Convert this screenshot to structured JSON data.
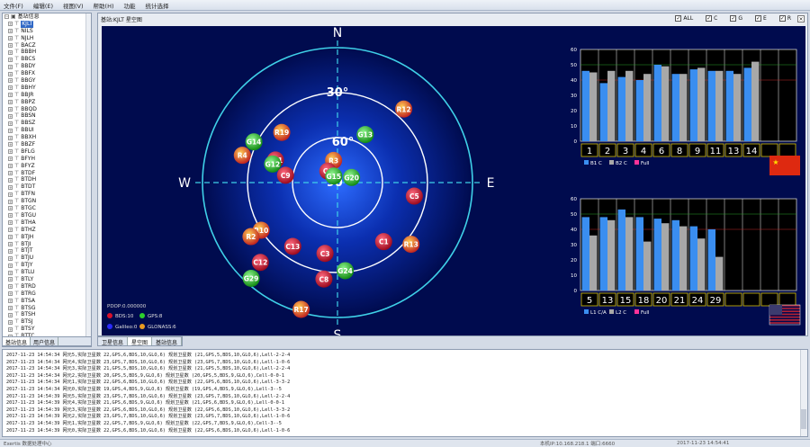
{
  "menu": [
    "文件(F)",
    "编辑(E)",
    "视图(V)",
    "帮助(H)",
    "功能",
    "统计选择"
  ],
  "tree": {
    "root": "基站信息",
    "items": [
      "KJLT",
      "NILS",
      "NJLH",
      "BACZ",
      "BBBH",
      "BBCS",
      "BBDY",
      "BBFX",
      "BBGY",
      "BBHY",
      "BBJR",
      "BBPZ",
      "BBQD",
      "BBSN",
      "BBSZ",
      "BBUI",
      "BBXH",
      "BBZF",
      "BFLG",
      "BFYH",
      "BFYZ",
      "BTDF",
      "BTDH",
      "BTDT",
      "BTFN",
      "BTGN",
      "BTGC",
      "BTGU",
      "BTHA",
      "BTHZ",
      "BTJH",
      "BTJI",
      "BTJT",
      "BTJU",
      "BTJY",
      "BTLU",
      "BTLY",
      "BTRD",
      "BTRG",
      "BTSA",
      "BTSG",
      "BTSH",
      "BTSJ",
      "BTSY",
      "BTTC",
      "BTTX"
    ],
    "selected": "KJLT"
  },
  "left_tabs": [
    "基站信息",
    "用户信息"
  ],
  "main": {
    "title": "基站:KJLT 星空图",
    "checkboxes": [
      {
        "label": "ALL",
        "checked": "✓"
      },
      {
        "label": "C",
        "checked": "✓"
      },
      {
        "label": "G",
        "checked": "✓"
      },
      {
        "label": "E",
        "checked": "✓"
      },
      {
        "label": "R",
        "checked": "✓"
      }
    ],
    "close": "×"
  },
  "main_tabs": [
    "卫星信息",
    "星空图",
    "基站信息"
  ],
  "sky": {
    "N": "N",
    "S": "S",
    "E": "E",
    "W": "W",
    "rings": [
      "30°",
      "60°",
      "90°"
    ],
    "pdop": "PDOP:0.000000",
    "legend": [
      {
        "label": "BDS:10",
        "color": "#d8102a"
      },
      {
        "label": "GPS:8",
        "color": "#2ccf2c"
      },
      {
        "label": "Galileo:0",
        "color": "#2a2aff"
      },
      {
        "label": "GLONASS:6",
        "color": "#e89a20"
      }
    ],
    "satellites": [
      {
        "id": "R19",
        "sys": "R",
        "az": 312,
        "el": 40
      },
      {
        "id": "G14",
        "sys": "G",
        "az": 296,
        "el": 28
      },
      {
        "id": "R4",
        "sys": "R",
        "az": 286,
        "el": 24
      },
      {
        "id": "C11",
        "sys": "C",
        "az": 290,
        "el": 46
      },
      {
        "id": "G12",
        "sys": "G",
        "az": 286,
        "el": 45
      },
      {
        "id": "C9",
        "sys": "C",
        "az": 278,
        "el": 55
      },
      {
        "id": "R3",
        "sys": "R",
        "az": 350,
        "el": 75
      },
      {
        "id": "C6",
        "sys": "C",
        "az": 320,
        "el": 80
      },
      {
        "id": "G15",
        "sys": "G",
        "az": 330,
        "el": 85
      },
      {
        "id": "G20",
        "sys": "G",
        "az": 70,
        "el": 80
      },
      {
        "id": "G13",
        "sys": "G",
        "az": 30,
        "el": 53
      },
      {
        "id": "R12",
        "sys": "R",
        "az": 42,
        "el": 24
      },
      {
        "id": "C5",
        "sys": "C",
        "az": 100,
        "el": 38
      },
      {
        "id": "R13",
        "sys": "R",
        "az": 130,
        "el": 26
      },
      {
        "id": "R10",
        "sys": "R",
        "az": 238,
        "el": 30
      },
      {
        "id": "R2",
        "sys": "R",
        "az": 238,
        "el": 22
      },
      {
        "id": "C12",
        "sys": "C",
        "az": 224,
        "el": 16
      },
      {
        "id": "C13",
        "sys": "C",
        "az": 215,
        "el": 38
      },
      {
        "id": "C3",
        "sys": "C",
        "az": 190,
        "el": 42
      },
      {
        "id": "C1",
        "sys": "C",
        "az": 142,
        "el": 40
      },
      {
        "id": "G24",
        "sys": "G",
        "az": 175,
        "el": 31
      },
      {
        "id": "C8",
        "sys": "C",
        "az": 188,
        "el": 25
      },
      {
        "id": "G29",
        "sys": "G",
        "az": 222,
        "el": 4
      },
      {
        "id": "R17",
        "sys": "R",
        "az": 196,
        "el": 2
      }
    ]
  },
  "snr_top": {
    "y_ticks": [
      "60",
      "50",
      "40",
      "30",
      "20",
      "10",
      "0"
    ],
    "sats": [
      "1",
      "2",
      "3",
      "4",
      "6",
      "8",
      "9",
      "11",
      "13",
      "14"
    ],
    "b1": [
      46,
      38,
      42,
      40,
      50,
      44,
      47,
      46,
      46,
      48
    ],
    "b2": [
      45,
      46,
      46,
      44,
      49,
      44,
      48,
      46,
      44,
      52
    ],
    "legend": [
      "B1 C",
      "B2 C",
      "Full"
    ],
    "flag": "china-flag"
  },
  "snr_bottom": {
    "y_ticks": [
      "60",
      "50",
      "40",
      "30",
      "20",
      "10",
      "0"
    ],
    "sats": [
      "5",
      "13",
      "15",
      "18",
      "20",
      "21",
      "24",
      "29"
    ],
    "l1": [
      48,
      48,
      53,
      48,
      47,
      46,
      42,
      40
    ],
    "l2": [
      36,
      46,
      48,
      32,
      44,
      42,
      34,
      22
    ],
    "legend": [
      "L1 C/A",
      "L2 C",
      "Full"
    ],
    "flag": "usa-flag"
  },
  "log": [
    "2017-11-23 14:54:34   网元5,实际卫星数  22,GPS,6,BDS,10,GLO,6)  规划卫星数  (21,GPS,5,BDS,10,GLO,6),Lell-2-2-4",
    "2017-11-23 14:54:34   网元4,实际卫星数  23,GPS,7,BDS,10,GLO,6)  规划卫星数  (23,GPS,7,BDS,10,GLO,6),Lell-1-0-6",
    "2017-11-23 14:54:34   网元3,实际卫星数  21,GPS,5,BDS,10,GLO,6)  规划卫星数  (21,GPS,5,BDS,10,GLO,6),Lell-2-2-4",
    "2017-11-23 14:54:34   网元2,实际卫星数  20,GPS,5,BDS,9,GLO,6)  规划卫星数  (20,GPS,5,BDS,9,GLO,6),Cell-0-0-1",
    "2017-11-23 14:54:34   网元1,实际卫星数  22,GPS,6,BDS,10,GLO,6)  规划卫星数  (22,GPS,6,BDS,10,GLO,6),Lell-3-3-2",
    "2017-11-23 14:54:34   网元0,实际卫星数  19,GPS,4,BDS,9,GLO,6)  规划卫星数  (19,GPS,4,BDS,9,GLO,6),Lell-3--5",
    "2017-11-23 14:54:39   网元5,实际卫星数  23,GPS,7,BDS,10,GLO,6)  规划卫星数  (23,GPS,7,BDS,10,GLO,6),Lell-2-2-4",
    "2017-11-23 14:54:39   网元4,实际卫星数  21,GPS,6,BDS,9,GLO,6)  规划卫星数  (21,GPS,6,BDS,9,GLO,6),Lell-0-0-1",
    "2017-11-23 14:54:39   网元3,实际卫星数  22,GPS,6,BDS,10,GLO,6)  规划卫星数  (22,GPS,6,BDS,10,GLO,6),Lell-3-3-2",
    "2017-11-23 14:54:39   网元2,实际卫星数  23,GPS,7,BDS,10,GLO,6)  规划卫星数  (23,GPS,7,BDS,10,GLO,6),Lell-1-0-6",
    "2017-11-23 14:54:39   网元1,实际卫星数  22,GPS,7,BDS,9,GLO,6)  规划卫星数  (22,GPS,7,BDS,9,GLO,6),Cell-3--5",
    "2017-11-23 14:54:39   网元0,实际卫星数  22,GPS,6,BDS,10,GLO,6)  规划卫星数  (22,GPS,6,BDS,10,GLO,6),Lell-1-0-6"
  ],
  "status": {
    "left": "Exertis 数据处理中心",
    "ip": "本机IP:10.168.218.1  端口:6660",
    "time": "2017-11-23 14:54:41"
  }
}
